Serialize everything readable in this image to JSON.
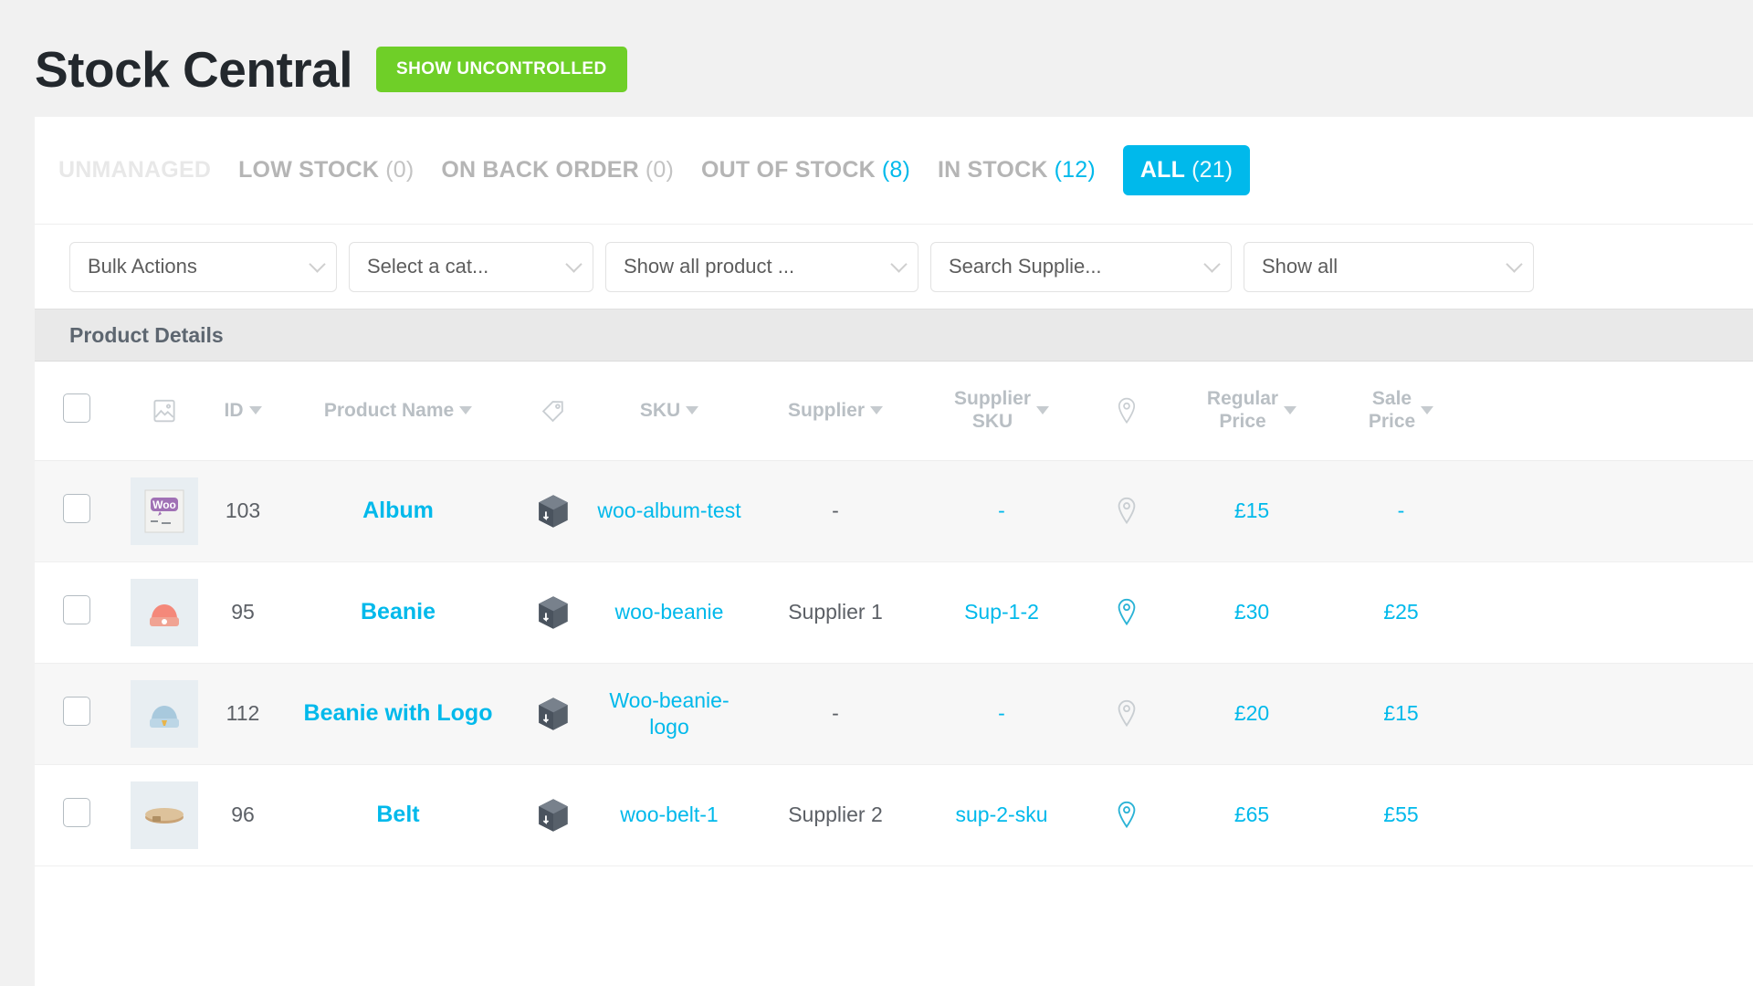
{
  "header": {
    "title": "Stock Central",
    "uncontrolled_button": "SHOW UNCONTROLLED"
  },
  "tabs": [
    {
      "label": "ALL",
      "count": "(21)",
      "active": true,
      "faded": false,
      "accent_count": false
    },
    {
      "label": "IN STOCK",
      "count": "(12)",
      "active": false,
      "faded": false,
      "accent_count": true
    },
    {
      "label": "OUT OF STOCK",
      "count": "(8)",
      "active": false,
      "faded": false,
      "accent_count": true
    },
    {
      "label": "ON BACK ORDER",
      "count": "(0)",
      "active": false,
      "faded": false,
      "accent_count": false
    },
    {
      "label": "LOW STOCK",
      "count": "(0)",
      "active": false,
      "faded": false,
      "accent_count": false
    },
    {
      "label": "UNMANAGED",
      "count": "",
      "active": false,
      "faded": true,
      "accent_count": false
    }
  ],
  "filters": [
    {
      "name": "bulk-actions-select",
      "value": "Bulk Actions"
    },
    {
      "name": "category-select",
      "value": "Select a cat..."
    },
    {
      "name": "product-type-select",
      "value": "Show all product ..."
    },
    {
      "name": "supplier-select",
      "value": "Search Supplie..."
    },
    {
      "name": "extra-filter-select",
      "value": "Show all"
    }
  ],
  "group_header": "Product Details",
  "columns": {
    "id": "ID",
    "product_name": "Product Name",
    "sku": "SKU",
    "supplier": "Supplier",
    "supplier_sku_line1": "Supplier",
    "supplier_sku_line2": "SKU",
    "regular_price_line1": "Regular",
    "regular_price_line2": "Price",
    "sale_price_line1": "Sale",
    "sale_price_line2": "Price"
  },
  "colors": {
    "accent": "#00b9eb",
    "green": "#6fcf28",
    "title": "#23282d",
    "muted": "#b9bfc4"
  },
  "rows": [
    {
      "id": "103",
      "name": "Album",
      "thumb": "album-thumb",
      "sku": "woo-album-test",
      "supplier": "-",
      "supplier_is_link": false,
      "supplier_sku": "-",
      "supplier_sku_is_link": true,
      "location_active": false,
      "regular_price": "£15",
      "sale_price": "-",
      "sale_is_dash": true
    },
    {
      "id": "95",
      "name": "Beanie",
      "thumb": "beanie-orange-thumb",
      "sku": "woo-beanie",
      "supplier": "Supplier 1",
      "supplier_is_link": false,
      "supplier_sku": "Sup-1-2",
      "supplier_sku_is_link": true,
      "location_active": true,
      "regular_price": "£30",
      "sale_price": "£25",
      "sale_is_dash": false
    },
    {
      "id": "112",
      "name": "Beanie with Logo",
      "thumb": "beanie-blue-thumb",
      "sku": "Woo-beanie-logo",
      "supplier": "-",
      "supplier_is_link": false,
      "supplier_sku": "-",
      "supplier_sku_is_link": true,
      "location_active": false,
      "regular_price": "£20",
      "sale_price": "£15",
      "sale_is_dash": false
    },
    {
      "id": "96",
      "name": "Belt",
      "thumb": "belt-thumb",
      "sku": "woo-belt-1",
      "supplier": "Supplier 2",
      "supplier_is_link": false,
      "supplier_sku": "sup-2-sku",
      "supplier_sku_is_link": true,
      "location_active": true,
      "regular_price": "£65",
      "sale_price": "£55",
      "sale_is_dash": false
    }
  ]
}
